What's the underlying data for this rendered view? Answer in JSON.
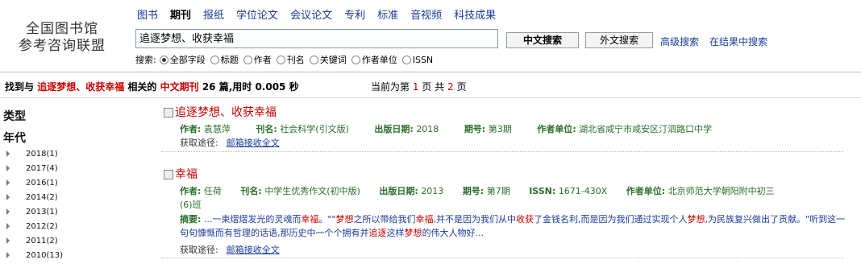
{
  "logo": {
    "line1": "全国图书馆",
    "line2": "参考咨询联盟"
  },
  "nav": [
    "图书",
    "期刊",
    "报纸",
    "学位论文",
    "会议论文",
    "专利",
    "标准",
    "音视频",
    "科技成果"
  ],
  "search": {
    "value": "追逐梦想、收获幸福",
    "btn_cn": "中文搜索",
    "btn_en": "外文搜索",
    "advanced": "高级搜索",
    "within": "在结果中搜索",
    "fields_label": "搜索:",
    "fields": [
      "全部字段",
      "标题",
      "作者",
      "刊名",
      "关键词",
      "作者单位",
      "ISSN"
    ]
  },
  "summary": {
    "p1": "找到与",
    "query": "追逐梦想、收获幸福",
    "p2": "相关的",
    "type": "中文期刊",
    "count": "26",
    "p3": "篇,用时",
    "time": "0.005",
    "p4": "秒"
  },
  "pageinfo": {
    "p1": "当前为第",
    "current": "1",
    "p2": "页 共",
    "total": "2",
    "p3": "页"
  },
  "sidebar": {
    "type_heading": "类型",
    "year_heading": "年代",
    "years": [
      "2018(1)",
      "2017(4)",
      "2016(1)",
      "2014(2)",
      "2013(1)",
      "2012(2)",
      "2011(2)",
      "2010(13)"
    ]
  },
  "results": [
    {
      "title": "追逐梦想、收获幸福",
      "author_label": "作者:",
      "author": "袁慧萍",
      "journal_label": "刊名:",
      "journal": "社会科学(引文版)",
      "date_label": "出版日期:",
      "date": "2018",
      "issue_label": "期号:",
      "issue": "第3期",
      "unit_label": "作者单位:",
      "unit": "湖北省咸宁市咸安区汀泗路口中学",
      "get_label": "获取途径:",
      "get_link": "邮箱接收全文"
    },
    {
      "title": "幸福",
      "author_label": "作者:",
      "author": "任荷",
      "journal_label": "刊名:",
      "journal": "中学生优秀作文(初中版)",
      "date_label": "出版日期:",
      "date": "2013",
      "issue_label": "期号:",
      "issue": "第7期",
      "issn_label": "ISSN:",
      "issn": "1671-430X",
      "unit_label": "作者单位:",
      "unit": "北京师范大学朝阳附中初三",
      "unit2": "(6)班",
      "abstract_label": "摘要:",
      "abstract": {
        "a1": "...一束熠熠发光的灵魂而",
        "h1": "幸福",
        "a2": "。\"\"",
        "h2": "梦想",
        "a3": "之所以带给我们",
        "h3": "幸福",
        "a4": ",并不是因为我们从中",
        "h4": "收获",
        "a5": "了金钱名利,而是因为我们通过实现个人",
        "h5": "梦想",
        "a6": ",为民族复兴做出",
        "a7": "了贡献。\"听到这一句句慷慨而有哲理的话语,那历史中一个个拥有并",
        "h6": "追逐",
        "a8": "这样",
        "h7": "梦想",
        "a9": "的伟大人物好..."
      },
      "get_label": "获取途径:",
      "get_link": "邮箱接收全文"
    }
  ]
}
